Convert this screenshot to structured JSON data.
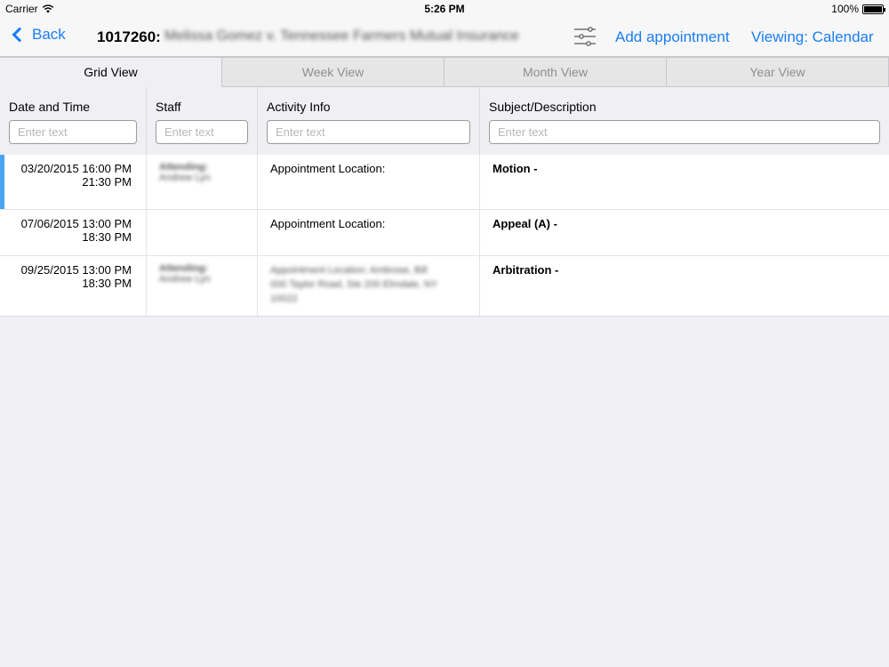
{
  "status_bar": {
    "carrier": "Carrier",
    "time": "5:26 PM",
    "battery": "100%"
  },
  "nav": {
    "back_label": "Back",
    "record_number": "1017260:",
    "record_name": "Melissa Gomez v. Tennessee Farmers Mutual Insurance",
    "add_appointment": "Add appointment",
    "viewing": "Viewing: Calendar"
  },
  "tabs": [
    {
      "label": "Grid View",
      "active": true
    },
    {
      "label": "Week View",
      "active": false
    },
    {
      "label": "Month View",
      "active": false
    },
    {
      "label": "Year View",
      "active": false
    }
  ],
  "columns": [
    {
      "header": "Date and Time",
      "placeholder": "Enter text"
    },
    {
      "header": "Staff",
      "placeholder": "Enter text"
    },
    {
      "header": "Activity Info",
      "placeholder": "Enter text"
    },
    {
      "header": "Subject/Description",
      "placeholder": "Enter text"
    }
  ],
  "rows": [
    {
      "start": "03/20/2015 16:00 PM",
      "end": "21:30 PM",
      "staff_line1": "Attending:",
      "staff_line2": "Andrew Lyn",
      "activity": "Appointment Location:",
      "activity_detail": "",
      "subject": "Motion -",
      "selected": true
    },
    {
      "start": "07/06/2015 13:00 PM",
      "end": "18:30 PM",
      "staff_line1": "",
      "staff_line2": "",
      "activity": "Appointment Location:",
      "activity_detail": "",
      "subject": "Appeal (A) -",
      "selected": false
    },
    {
      "start": "09/25/2015 13:00 PM",
      "end": "18:30 PM",
      "staff_line1": "Attending:",
      "staff_line2": "Andrew Lyn",
      "activity": "Appointment Location: Ambrose, Bill",
      "activity_detail": "000 Taylor Road, Ste 200 Elmdale, NY 10022",
      "subject": "Arbitration -",
      "selected": false
    }
  ],
  "colors": {
    "accent": "#1a7ef5",
    "selected_marker": "#4aa3f5",
    "background": "#efeff4"
  }
}
